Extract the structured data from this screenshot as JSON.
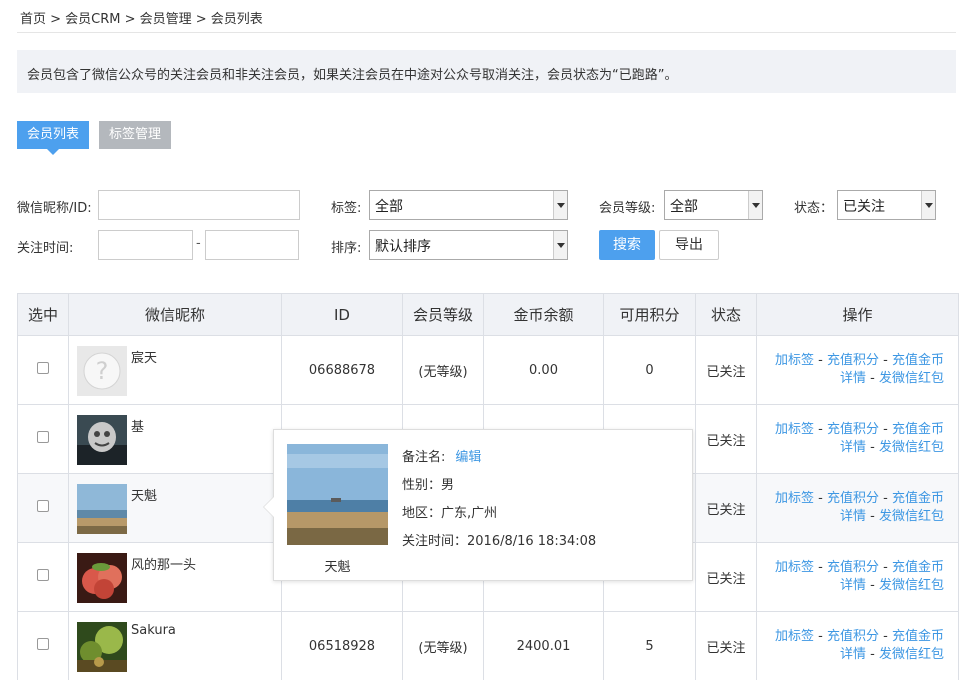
{
  "breadcrumb": "首页 > 会员CRM > 会员管理 > 会员列表",
  "notice": "会员包含了微信公众号的关注会员和非关注会员，如果关注会员在中途对公众号取消关注，会员状态为“已跑路”。",
  "tabs": {
    "active": "会员列表",
    "inactive": "标签管理"
  },
  "filters": {
    "nickname_label": "微信昵称/ID:",
    "nickname_value": "",
    "tag_label": "标签:",
    "tag_value": "全部",
    "level_label": "会员等级:",
    "level_value": "全部",
    "status_label": "状态：",
    "status_value": "已关注",
    "follow_time_label": "关注时间:",
    "follow_time_sep": "-",
    "sort_label": "排序:",
    "sort_value": "默认排序",
    "search_button": "搜索",
    "export_button": "导出"
  },
  "table": {
    "headers": [
      "选中",
      "微信昵称",
      "ID",
      "会员等级",
      "金币余额",
      "可用积分",
      "状态",
      "操作"
    ],
    "rows": [
      {
        "nickname": "宸天",
        "id": "06688678",
        "level": "(无等级)",
        "coins": "0.00",
        "points": "0",
        "status": "已关注"
      },
      {
        "nickname": "基",
        "id": "",
        "level": "",
        "coins": "",
        "points": "",
        "status": "已关注"
      },
      {
        "nickname": "天魁",
        "id": "",
        "level": "",
        "coins": "",
        "points": "",
        "status": "已关注"
      },
      {
        "nickname": "风的那一头",
        "id": "",
        "level": "",
        "coins": "",
        "points": "",
        "status": "已关注"
      },
      {
        "nickname": "Sakura",
        "id": "06518928",
        "level": "(无等级)",
        "coins": "2400.01",
        "points": "5",
        "status": "已关注"
      }
    ],
    "ops": {
      "add_tag": "加标签",
      "recharge_points": "充值积分",
      "recharge_coins": "充值金币",
      "details": "详情",
      "send_red_packet": "发微信红包",
      "sep": "-"
    }
  },
  "popup": {
    "name": "天魁",
    "remark_label": "备注名:",
    "remark_edit": "编辑",
    "gender": "性别：男",
    "region": "地区：广东,广州",
    "follow_time": "关注时间：2016/8/16 18:34:08"
  },
  "colors": {
    "accent": "#4da0ee",
    "link": "#3d97e3",
    "header_bg": "#f0f2f6"
  }
}
